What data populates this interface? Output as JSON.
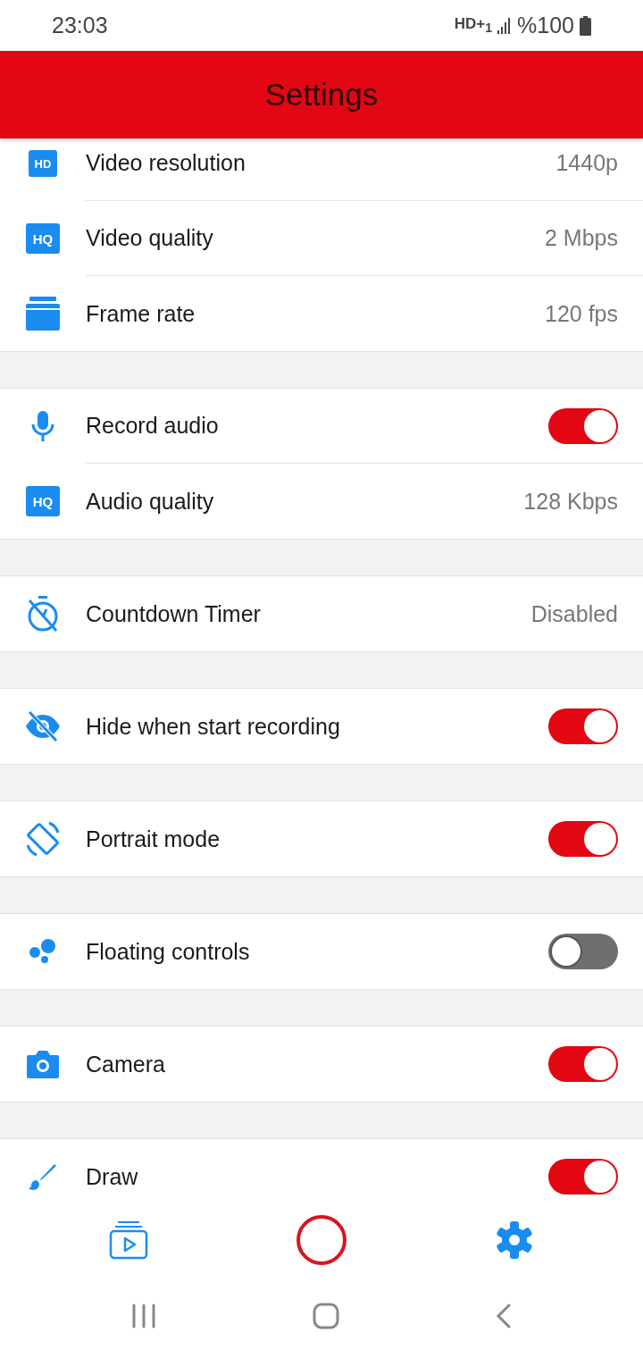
{
  "status_bar": {
    "time": "23:03",
    "network": "HD+$_{1}$",
    "battery": "%100"
  },
  "header": {
    "title": "Settings"
  },
  "groups": [
    [
      {
        "kind": "value",
        "badge": "HD",
        "label": "Video resolution",
        "value": "1440p"
      },
      {
        "kind": "value",
        "badge": "HQ",
        "label": "Video quality",
        "value": "2 Mbps"
      },
      {
        "kind": "value",
        "label": "Frame rate",
        "value": "120 fps"
      }
    ],
    [
      {
        "kind": "toggle",
        "label": "Record audio",
        "on": true
      },
      {
        "kind": "value",
        "badge": "HQ",
        "label": "Audio quality",
        "value": "128 Kbps"
      }
    ],
    [
      {
        "kind": "value",
        "label": "Countdown Timer",
        "value": "Disabled"
      }
    ],
    [
      {
        "kind": "toggle",
        "label": "Hide when start recording",
        "on": true
      }
    ],
    [
      {
        "kind": "toggle",
        "label": "Portrait mode",
        "on": true
      }
    ],
    [
      {
        "kind": "toggle",
        "label": "Floating controls",
        "on": false
      }
    ],
    [
      {
        "kind": "toggle",
        "label": "Camera",
        "on": true
      }
    ],
    [
      {
        "kind": "toggle",
        "label": "Draw",
        "on": true
      }
    ]
  ]
}
